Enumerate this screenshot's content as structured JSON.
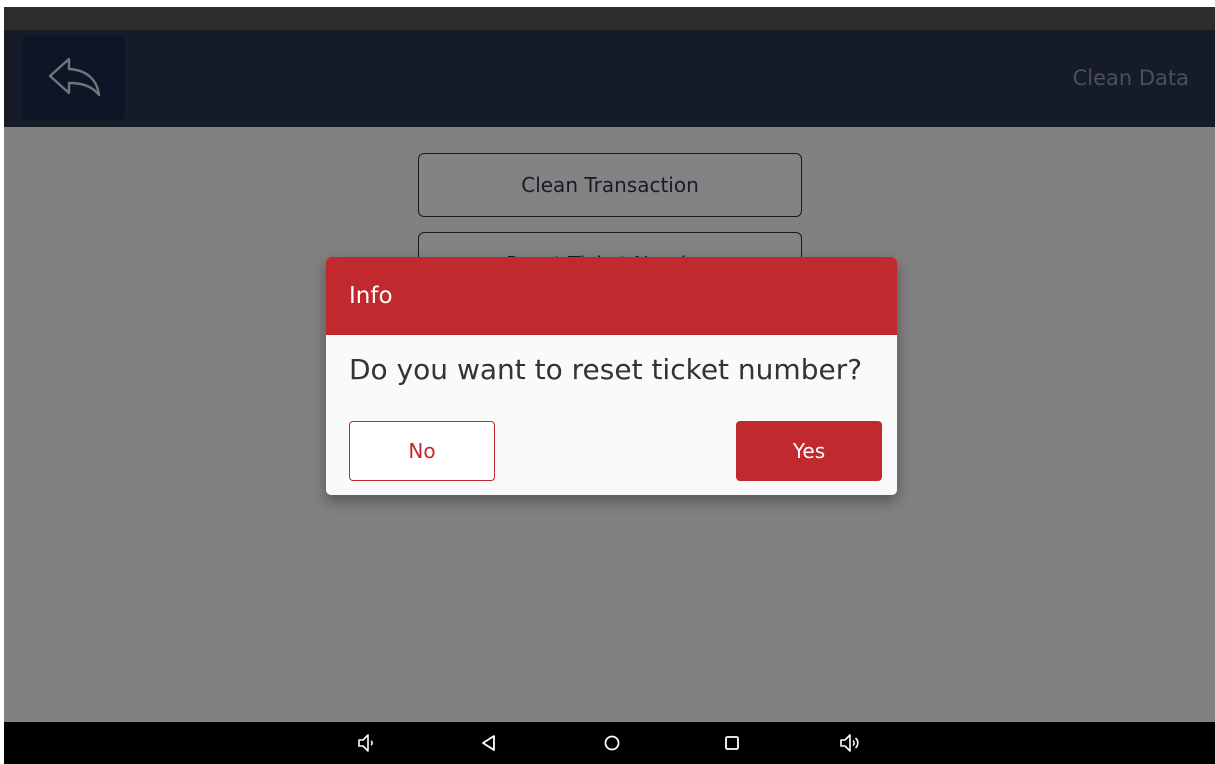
{
  "app_bar": {
    "title": "Clean Data",
    "back_icon": "reply-arrow-icon"
  },
  "options": [
    {
      "label": "Clean Transaction"
    },
    {
      "label": "Reset Ticket Number"
    }
  ],
  "dialog": {
    "title": "Info",
    "message": "Do you want to reset ticket number?",
    "no_label": "No",
    "yes_label": "Yes"
  },
  "nav_bar": {
    "icons": [
      "volume-down-icon",
      "back-triangle-icon",
      "home-circle-icon",
      "recents-square-icon",
      "volume-up-icon"
    ]
  },
  "colors": {
    "app_bar": "#2b364a",
    "back_button": "#1a2a4b",
    "accent_red": "#c02a2e",
    "status_bar": "#555555",
    "nav_bar": "#000000"
  }
}
